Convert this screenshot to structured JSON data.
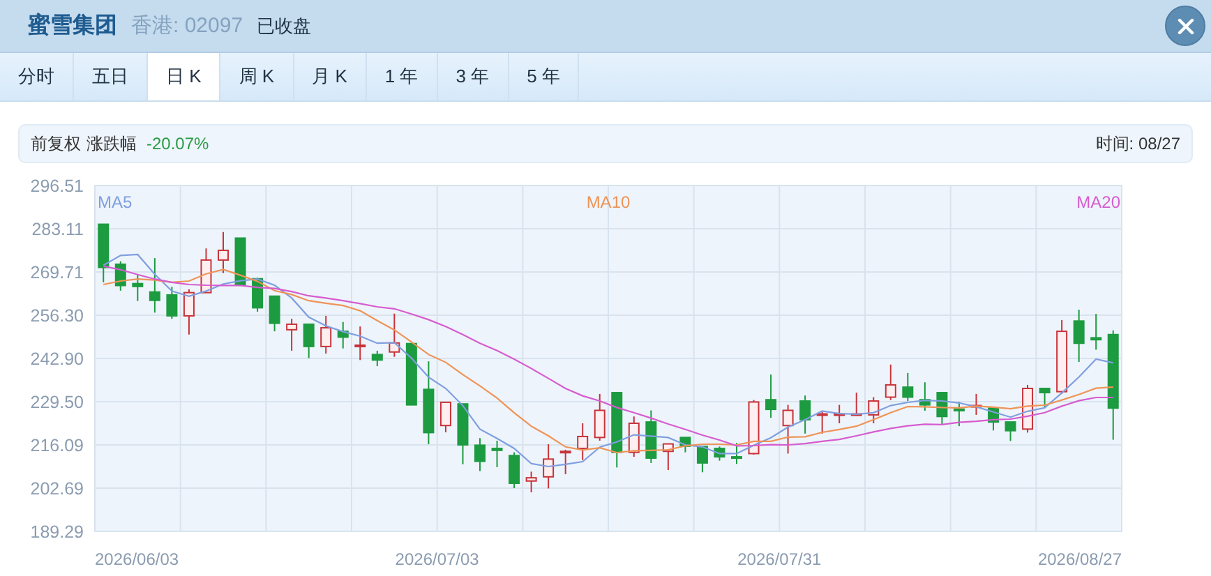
{
  "header": {
    "name": "蜜雪集团",
    "market_code": "香港: 02097",
    "status": "已收盘"
  },
  "tabs": [
    {
      "label": "分时",
      "selected": false
    },
    {
      "label": "五日",
      "selected": false
    },
    {
      "label": "日 K",
      "selected": true
    },
    {
      "label": "周 K",
      "selected": false
    },
    {
      "label": "月 K",
      "selected": false
    },
    {
      "label": "1 年",
      "selected": false
    },
    {
      "label": "3 年",
      "selected": false
    },
    {
      "label": "5 年",
      "selected": false
    }
  ],
  "info_bar": {
    "adjustment": "前复权",
    "change_label": "涨跌幅",
    "change_value": "-20.07%",
    "time": "时间: 08/27"
  },
  "chart": {
    "chart_data": {
      "type": "candlestick",
      "ylim": [
        189.29,
        296.51
      ],
      "grid": true,
      "yticks": [
        {
          "value": 296.51,
          "label": "296.51"
        },
        {
          "value": 283.11,
          "label": "283.11"
        },
        {
          "value": 269.71,
          "label": "269.71"
        },
        {
          "value": 256.3,
          "label": "256.30"
        },
        {
          "value": 242.9,
          "label": "242.90"
        },
        {
          "value": 229.5,
          "label": "229.50"
        },
        {
          "value": 216.09,
          "label": "216.09"
        },
        {
          "value": 202.69,
          "label": "202.69"
        },
        {
          "value": 189.29,
          "label": "189.29"
        }
      ],
      "ohlc": [
        [
          284.5,
          284.5,
          266.5,
          271.1
        ],
        [
          272.1,
          273.0,
          263.9,
          265.5
        ],
        [
          266.1,
          268.7,
          260.7,
          265.2
        ],
        [
          263.5,
          274.0,
          257.1,
          260.9
        ],
        [
          262.6,
          265.1,
          255.2,
          256.1
        ],
        [
          256.1,
          264.3,
          250.3,
          263.3
        ],
        [
          263.3,
          277.0,
          263.3,
          273.4
        ],
        [
          273.4,
          282.1,
          269.4,
          276.4
        ],
        [
          280.2,
          280.2,
          265.8,
          265.8
        ],
        [
          267.6,
          267.9,
          257.4,
          258.6
        ],
        [
          262.2,
          262.2,
          251.3,
          253.8
        ],
        [
          251.8,
          255.2,
          245.3,
          253.5
        ],
        [
          253.5,
          253.5,
          243.0,
          246.6
        ],
        [
          246.6,
          256.1,
          244.4,
          252.4
        ],
        [
          251.3,
          254.2,
          246.0,
          249.5
        ],
        [
          246.7,
          252.8,
          242.4,
          247.0
        ],
        [
          244.1,
          245.3,
          240.5,
          242.4
        ],
        [
          244.9,
          256.8,
          243.4,
          247.7
        ],
        [
          247.5,
          247.5,
          228.5,
          228.5
        ],
        [
          233.3,
          242.0,
          216.3,
          219.9
        ],
        [
          222.1,
          229.3,
          220.0,
          229.3
        ],
        [
          228.8,
          228.8,
          210.1,
          216.1
        ],
        [
          216.0,
          218.2,
          208.0,
          211.0
        ],
        [
          215.0,
          217.4,
          209.2,
          214.4
        ],
        [
          212.8,
          213.8,
          202.7,
          204.2
        ],
        [
          204.9,
          207.8,
          201.4,
          205.9
        ],
        [
          206.2,
          216.3,
          202.6,
          211.7
        ],
        [
          213.8,
          214.6,
          207.0,
          214.1
        ],
        [
          215.0,
          222.8,
          211.4,
          218.7
        ],
        [
          218.4,
          231.9,
          217.4,
          226.8
        ],
        [
          232.3,
          232.3,
          209.1,
          213.8
        ],
        [
          213.8,
          224.9,
          212.4,
          222.8
        ],
        [
          223.2,
          226.8,
          210.5,
          212.0
        ],
        [
          214.1,
          216.4,
          208.3,
          216.4
        ],
        [
          218.4,
          218.4,
          213.8,
          215.7
        ],
        [
          215.6,
          215.6,
          207.6,
          210.5
        ],
        [
          215.0,
          215.6,
          211.2,
          212.4
        ],
        [
          212.4,
          216.7,
          210.2,
          212.1
        ],
        [
          213.4,
          230.0,
          213.1,
          229.4
        ],
        [
          230.1,
          237.9,
          224.5,
          227.1
        ],
        [
          222.1,
          228.5,
          213.4,
          226.8
        ],
        [
          229.7,
          231.4,
          219.6,
          223.9
        ],
        [
          225.4,
          226.4,
          219.6,
          225.7
        ],
        [
          225.4,
          228.5,
          222.8,
          225.7
        ],
        [
          225.4,
          232.3,
          225.1,
          225.7
        ],
        [
          225.4,
          230.9,
          222.8,
          229.7
        ],
        [
          230.9,
          241.0,
          230.0,
          234.7
        ],
        [
          234.0,
          238.4,
          229.7,
          230.9
        ],
        [
          230.1,
          235.5,
          226.7,
          228.5
        ],
        [
          232.3,
          232.3,
          222.3,
          224.9
        ],
        [
          227.2,
          229.4,
          221.9,
          226.7
        ],
        [
          228.0,
          231.9,
          225.4,
          228.3
        ],
        [
          227.5,
          227.5,
          220.6,
          223.2
        ],
        [
          223.2,
          223.2,
          217.3,
          220.5
        ],
        [
          221.0,
          234.7,
          219.9,
          233.6
        ],
        [
          233.6,
          233.6,
          227.8,
          232.3
        ],
        [
          232.6,
          254.8,
          231.9,
          251.3
        ],
        [
          254.5,
          258.0,
          241.8,
          247.6
        ],
        [
          249.3,
          256.7,
          245.6,
          248.7
        ],
        [
          250.3,
          251.6,
          217.7,
          227.5
        ]
      ]
    },
    "x_axis_labels": [
      "2026/06/03",
      "2026/07/03",
      "2026/07/31",
      "2026/08/27"
    ],
    "moving_averages": {
      "chart_data": {
        "type": "line",
        "ylim": [
          189.29,
          296.51
        ],
        "series": [
          {
            "name": "MA5",
            "color": "#7f9fdf",
            "values": [
              271.8,
              274.8,
              275.1,
              269.0,
              263.8,
              262.2,
              263.8,
              266.0,
              267.0,
              267.5,
              265.6,
              261.6,
              255.7,
              253.0,
              251.2,
              249.8,
              247.6,
              247.8,
              243.0,
              237.1,
              233.6,
              228.3,
              221.0,
              218.1,
              215.0,
              210.3,
              209.4,
              210.1,
              210.9,
              215.4,
              217.0,
              219.2,
              218.8,
              218.4,
              216.1,
              215.5,
              213.4,
              213.4,
              216.0,
              218.3,
              221.6,
              223.9,
              226.6,
              225.8,
              225.6,
              226.1,
              228.3,
              229.3,
              229.9,
              229.7,
              229.1,
              227.9,
              226.3,
              224.7,
              226.5,
              227.6,
              232.2,
              237.1,
              242.7,
              241.5
            ]
          },
          {
            "name": "MA10",
            "color": "#ee9458",
            "values": [
              265.8,
              266.9,
              267.5,
              267.2,
              266.5,
              266.9,
              269.1,
              270.5,
              268.7,
              266.8,
              263.9,
              262.7,
              260.8,
              260.0,
              259.3,
              257.7,
              254.6,
              251.7,
              248.0,
              244.1,
              241.7,
              237.9,
              234.4,
              230.6,
              226.1,
              221.9,
              218.9,
              215.5,
              214.5,
              215.2,
              213.7,
              214.3,
              214.4,
              214.6,
              215.8,
              216.3,
              216.3,
              216.1,
              217.2,
              217.2,
              218.5,
              218.6,
              220.0,
              220.9,
              221.9,
              223.9,
              226.1,
              228.0,
              227.9,
              227.7,
              227.6,
              228.1,
              227.8,
              227.3,
              228.1,
              228.4,
              230.0,
              231.7,
              233.7,
              234.0
            ]
          },
          {
            "name": "MA20",
            "color": "#d65ccf",
            "values": [
              271.5,
              270.4,
              268.9,
              267.5,
              266.5,
              265.8,
              265.6,
              265.5,
              265.5,
              264.9,
              264.6,
              263.6,
              262.3,
              261.6,
              260.8,
              259.9,
              258.9,
              258.3,
              256.7,
              254.9,
              252.8,
              250.3,
              247.6,
              245.3,
              242.7,
              239.8,
              236.7,
              233.6,
              231.3,
              229.7,
              227.7,
              226.1,
              224.4,
              222.6,
              220.9,
              219.1,
              217.6,
              215.8,
              215.9,
              216.2,
              216.1,
              216.5,
              217.2,
              217.8,
              218.9,
              220.1,
              221.2,
              222.0,
              222.5,
              222.4,
              223.1,
              223.4,
              223.9,
              224.1,
              225.0,
              226.1,
              228.1,
              229.8,
              230.8,
              230.8
            ]
          }
        ]
      }
    }
  }
}
